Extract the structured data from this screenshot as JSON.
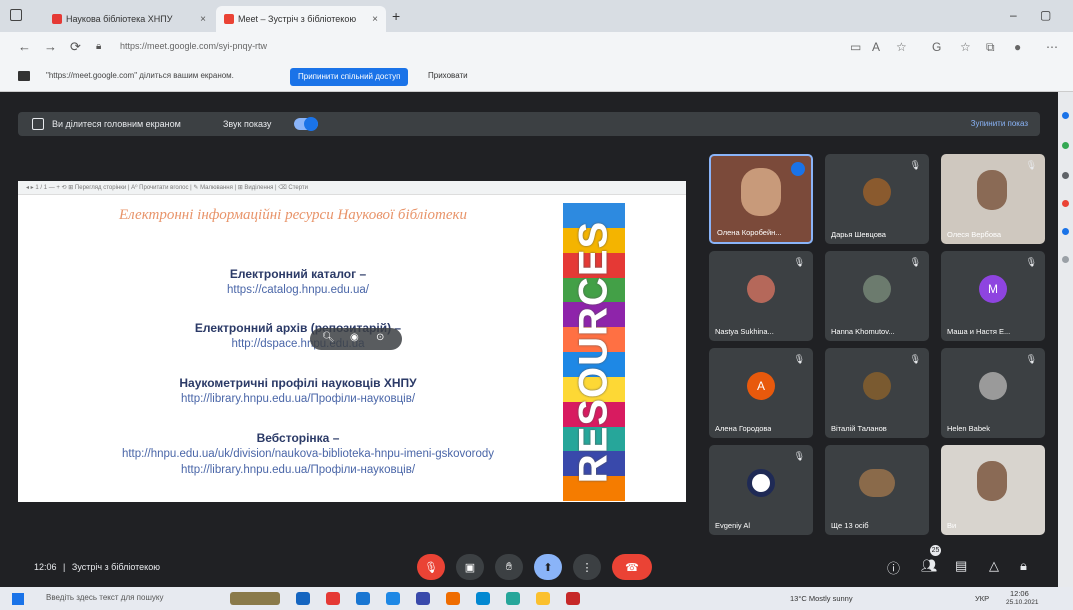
{
  "browser": {
    "tabs": [
      {
        "label": "Наукова бібліотека ХНПУ",
        "close": "×"
      },
      {
        "label": "Meet – Зустріч з бібліотекою",
        "close": "×"
      }
    ],
    "new_tab": "+",
    "window_controls": [
      "–",
      "▢"
    ],
    "url": "https://meet.google.com/syi-pnqy-rtw",
    "share_notice": "\"https://meet.google.com\" ділиться вашим екраном.",
    "share_stop_button": "Припинити спільний доступ",
    "share_hide_button": "Приховати"
  },
  "meet": {
    "presentation_bar": {
      "label": "Ви ділитеся головним екраном",
      "sound_label": "Звук показу",
      "stop_label": "Зупинити показ"
    },
    "slide": {
      "toolbar": "◂ ▸  1 / 1   —   +   ⟲   ⊞ Перегляд сторінки   |   A⁰ Прочитати вголос   |   ✎ Малювання   |   ⊞ Виділення   |   ⌫ Стерти",
      "title": "Електронні інформаційні ресурси Наукової бібліотеки",
      "sections": [
        {
          "heading": "Електронний каталог –",
          "links": [
            "https://catalog.hnpu.edu.ua/"
          ]
        },
        {
          "heading": "Електронний архів (репозитарій) –",
          "links": [
            "http://dspace.hnpu.edu.ua"
          ]
        },
        {
          "heading": "Наукометричні профілі науковців ХНПУ",
          "links": [
            "http://library.hnpu.edu.ua/Профіли-науковців/"
          ]
        },
        {
          "heading": "Вебсторінка –",
          "links": [
            "http://hnpu.edu.ua/uk/division/naukova-biblioteka-hnpu-imeni-gskovorody",
            "http://library.hnpu.edu.ua/Профіли-науковців/"
          ]
        }
      ],
      "side_banner": "RESOURCES",
      "banner_colors": [
        "#2d8ae0",
        "#f4b400",
        "#e53935",
        "#43a047",
        "#8e24aa",
        "#ff7043",
        "#1e88e5",
        "#fdd835",
        "#d81b60",
        "#26a69a",
        "#3949ab",
        "#f57c00"
      ]
    },
    "participants": [
      {
        "name": "Олена Коробейн...",
        "avatar": "photo",
        "color": "#7b4a3a",
        "active": true,
        "muted": false
      },
      {
        "name": "Дарья Шевцова",
        "avatar": "photo",
        "color": "#8a5a2e",
        "active": false,
        "muted": true
      },
      {
        "name": "Олеся Вербова",
        "avatar": "video",
        "color": "#cfc8bf",
        "active": false,
        "muted": true
      },
      {
        "name": "Nastya Sukhina...",
        "avatar": "photo",
        "color": "#b5685a",
        "active": false,
        "muted": true
      },
      {
        "name": "Hanna Khomutov...",
        "avatar": "photo",
        "color": "#6c7b6e",
        "active": false,
        "muted": true
      },
      {
        "name": "Маша и Настя Е...",
        "avatar": "M",
        "color": "#8e44e0",
        "active": false,
        "muted": true
      },
      {
        "name": "Алена Городова",
        "avatar": "A",
        "color": "#e8590c",
        "active": false,
        "muted": true
      },
      {
        "name": "Віталій Таланов",
        "avatar": "photo",
        "color": "#7a5a30",
        "active": false,
        "muted": true
      },
      {
        "name": "Helen Babek",
        "avatar": "photo",
        "color": "#9a9a9a",
        "active": false,
        "muted": true
      },
      {
        "name": "Evgeniy Al",
        "avatar": "obs",
        "color": "#1f2a55",
        "active": false,
        "muted": true
      },
      {
        "name": "Ще 13 осіб",
        "avatar": "group",
        "color": "#8a6a4a",
        "active": false,
        "muted": false
      },
      {
        "name": "Ви",
        "avatar": "video",
        "color": "#d8d4ce",
        "active": false,
        "muted": false
      }
    ],
    "bottom": {
      "time": "12:06",
      "separator": "|",
      "meeting_name": "Зустріч з бібліотекою",
      "controls": [
        "mic-off",
        "camera-off",
        "raise-hand",
        "present",
        "more",
        "leave"
      ],
      "people_count": "25"
    }
  },
  "taskbar": {
    "search_placeholder": "Введіть здесь текст для пошуку",
    "weather": "13°C  Mostly sunny",
    "lang": "УКР",
    "time": "12:06",
    "date": "25.10.2021"
  }
}
